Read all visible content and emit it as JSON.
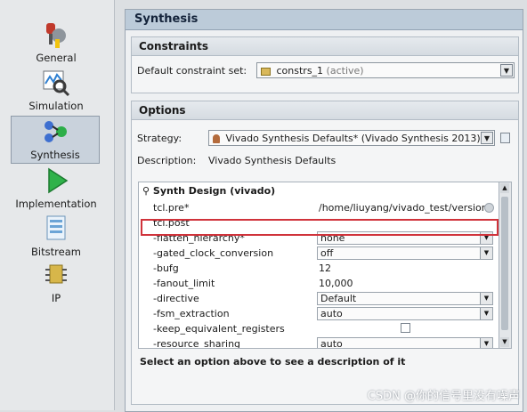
{
  "sidebar": {
    "items": [
      {
        "label": "General",
        "icon": "general-icon"
      },
      {
        "label": "Simulation",
        "icon": "simulation-icon"
      },
      {
        "label": "Synthesis",
        "icon": "synthesis-icon",
        "selected": true
      },
      {
        "label": "Implementation",
        "icon": "implementation-icon"
      },
      {
        "label": "Bitstream",
        "icon": "bitstream-icon"
      },
      {
        "label": "IP",
        "icon": "ip-icon"
      }
    ]
  },
  "main": {
    "title": "Synthesis",
    "constraints": {
      "heading": "Constraints",
      "label": "Default constraint set:",
      "value": "constrs_1",
      "value_suffix": "(active)"
    },
    "options": {
      "heading": "Options",
      "strategy_label": "Strategy:",
      "strategy_value": "Vivado Synthesis Defaults* (Vivado Synthesis 2013)",
      "description_label": "Description:",
      "description_value": "Vivado Synthesis Defaults",
      "group_title": "Synth Design (vivado)",
      "rows": [
        {
          "name": "tcl.pre*",
          "value": "/home/liuyang/vivado_test/version",
          "kind": "text"
        },
        {
          "name": "tcl.post",
          "value": "",
          "kind": "text"
        },
        {
          "name": "-flatten_hierarchy*",
          "value": "none",
          "kind": "combo"
        },
        {
          "name": "-gated_clock_conversion",
          "value": "off",
          "kind": "combo"
        },
        {
          "name": "-bufg",
          "value": "12",
          "kind": "text"
        },
        {
          "name": "-fanout_limit",
          "value": "10,000",
          "kind": "text"
        },
        {
          "name": "-directive",
          "value": "Default",
          "kind": "combo"
        },
        {
          "name": "-fsm_extraction",
          "value": "auto",
          "kind": "combo"
        },
        {
          "name": "-keep_equivalent_registers",
          "value": "",
          "kind": "checkbox"
        },
        {
          "name": "-resource_sharing",
          "value": "auto",
          "kind": "combo"
        }
      ],
      "footer_text": "Select an option above to see a description of it"
    }
  },
  "watermark": "CSDN @你的信号里没有噪声",
  "colors": {
    "highlight": "#d0333b",
    "title_bar": "#bccbd9"
  }
}
